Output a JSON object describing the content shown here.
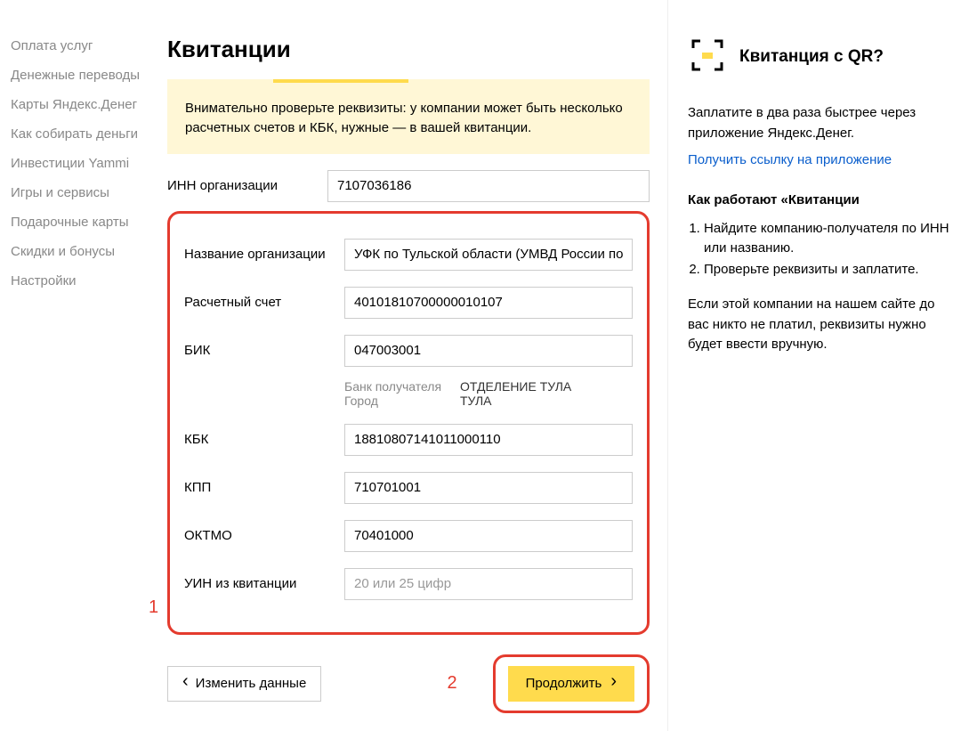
{
  "sidebar": {
    "items": [
      "Оплата услуг",
      "Денежные переводы",
      "Карты Яндекс.Денег",
      "Как собирать деньги",
      "Инвестиции Yammi",
      "Игры и сервисы",
      "Подарочные карты",
      "Скидки и бонусы",
      "Настройки"
    ]
  },
  "page_title": "Квитанции",
  "alert": "Внимательно проверьте реквизиты: у компании может быть несколько расчетных счетов и КБК, нужные — в вашей квитанции.",
  "form": {
    "inn": {
      "label": "ИНН организации",
      "value": "7107036186"
    },
    "name": {
      "label": "Название организации",
      "value": "УФК по Тульской области (УМВД России по Ту"
    },
    "account": {
      "label": "Расчетный счет",
      "value": "40101810700000010107"
    },
    "bik": {
      "label": "БИК",
      "value": "047003001"
    },
    "bank_label": "Банк получателя",
    "bank_value": "ОТДЕЛЕНИЕ ТУЛА",
    "city_label": "Город",
    "city_value": "ТУЛА",
    "kbk": {
      "label": "КБК",
      "value": "18810807141011000110"
    },
    "kpp": {
      "label": "КПП",
      "value": "710701001"
    },
    "oktmo": {
      "label": "ОКТМО",
      "value": "70401000"
    },
    "uin": {
      "label": "УИН из квитанции",
      "placeholder": "20 или 25 цифр",
      "value": ""
    }
  },
  "annotations": {
    "one": "1",
    "two": "2"
  },
  "buttons": {
    "back": "Изменить данные",
    "continue": "Продолжить"
  },
  "right": {
    "title": "Квитанция с QR?",
    "p1": "Заплатите в два раза быстрее через приложение Яндекс.Денег.",
    "link": "Получить ссылку на приложение",
    "subhead": "Как работают «Квитанции",
    "steps": [
      "Найдите компанию-получателя по ИНН или названию.",
      "Проверьте реквизиты и заплатите."
    ],
    "note": "Если этой компании на нашем сайте до вас никто не платил, реквизиты нужно будет ввести вручную."
  }
}
